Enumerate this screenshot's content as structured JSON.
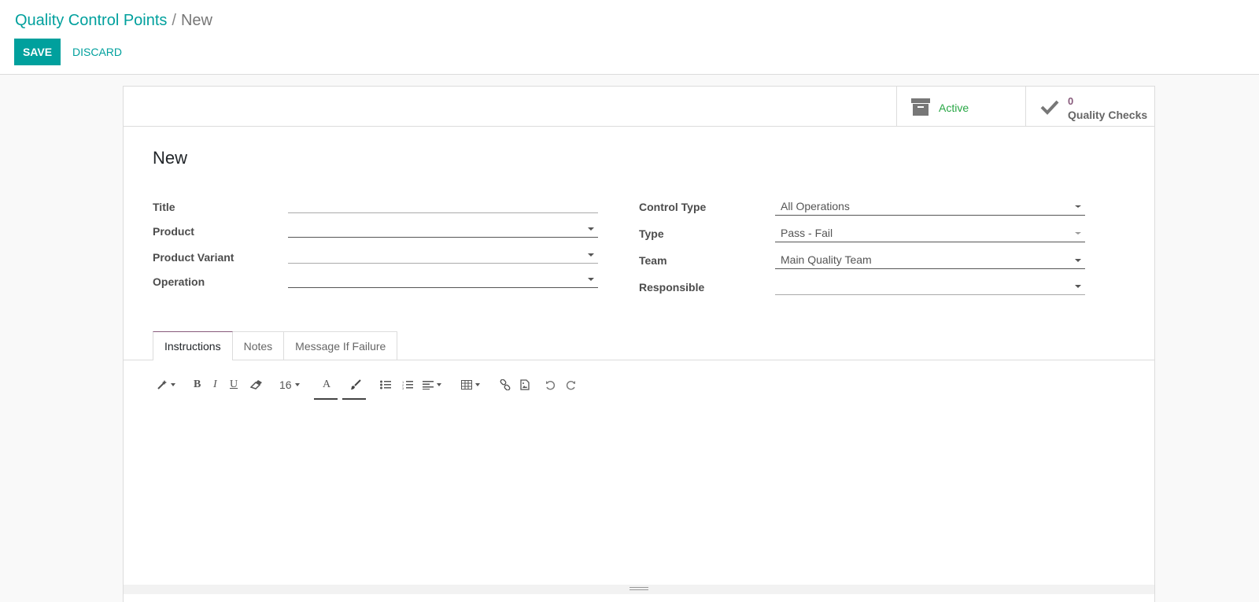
{
  "breadcrumb": {
    "parent": "Quality Control Points",
    "separator": "/",
    "current": "New"
  },
  "actions": {
    "save_label": "SAVE",
    "discard_label": "DISCARD"
  },
  "stat_buttons": {
    "active": {
      "icon": "archive-icon",
      "label": "Active"
    },
    "quality_checks": {
      "icon": "check-icon",
      "value": "0",
      "label": "Quality Checks"
    }
  },
  "record": {
    "name": "New"
  },
  "left_fields": {
    "title": {
      "label": "Title",
      "value": ""
    },
    "product": {
      "label": "Product",
      "value": ""
    },
    "product_variant": {
      "label": "Product Variant",
      "value": ""
    },
    "operation": {
      "label": "Operation",
      "value": ""
    }
  },
  "right_fields": {
    "control_type": {
      "label": "Control Type",
      "value": "All Operations"
    },
    "type": {
      "label": "Type",
      "value": "Pass - Fail"
    },
    "team": {
      "label": "Team",
      "value": "Main Quality Team"
    },
    "responsible": {
      "label": "Responsible",
      "value": ""
    }
  },
  "tabs": [
    {
      "label": "Instructions",
      "active": true
    },
    {
      "label": "Notes",
      "active": false
    },
    {
      "label": "Message If Failure",
      "active": false
    }
  ],
  "toolbar": {
    "style": "magic-wand-icon",
    "bold": "B",
    "italic": "I",
    "underline": "U",
    "eraser": "eraser-icon",
    "font_size": "16",
    "font_color": "A",
    "highlight": "paintbrush-icon",
    "list_ul": "bullet-list-icon",
    "list_ol": "numbered-list-icon",
    "align": "align-left-icon",
    "table": "table-icon",
    "link": "link-icon",
    "image": "image-icon",
    "undo": "undo-icon",
    "redo": "redo-icon"
  },
  "colors": {
    "accent": "#00A09D",
    "active_green": "#28a745",
    "purple": "#875A7B"
  }
}
